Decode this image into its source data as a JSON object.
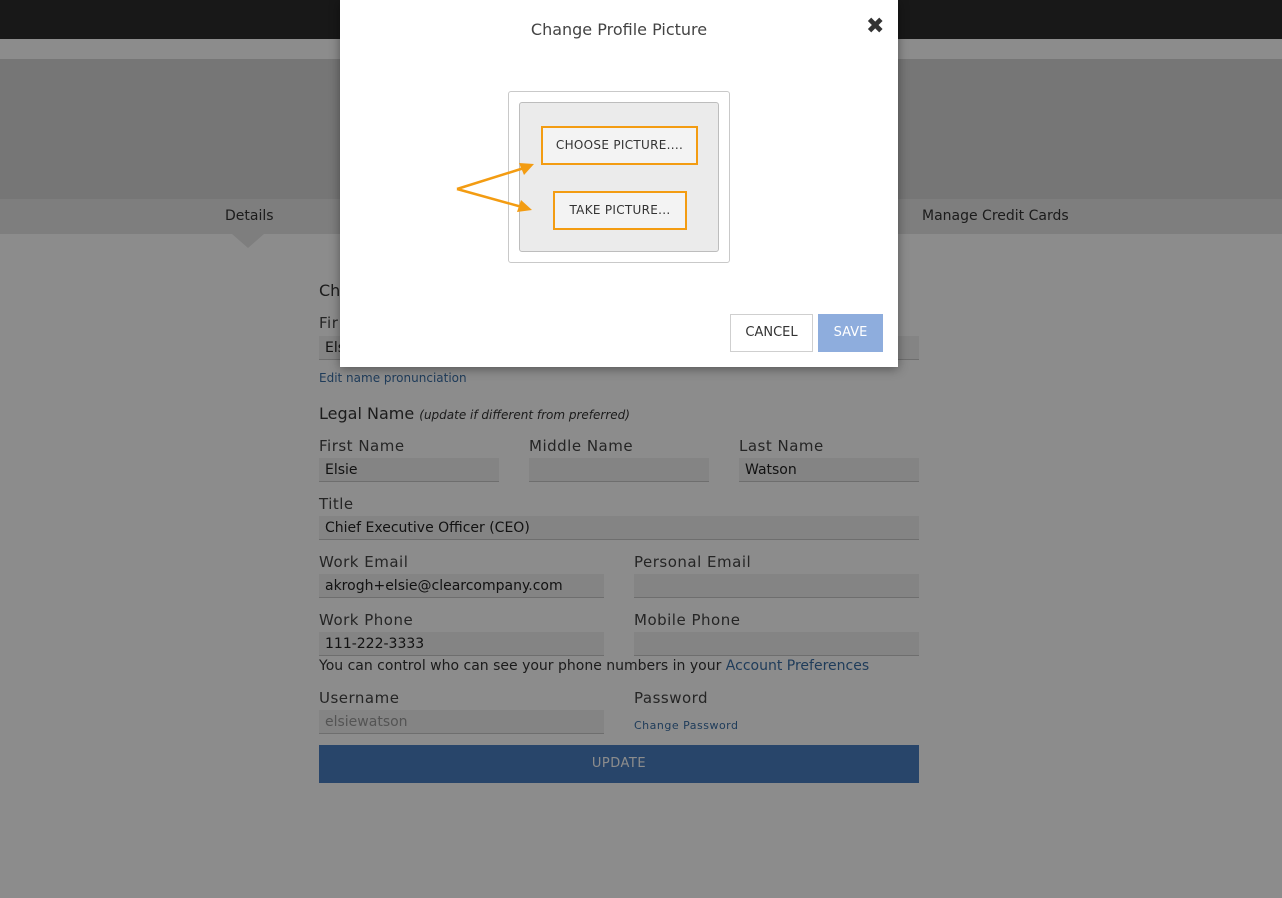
{
  "tabs": {
    "details": "Details",
    "manage_credit_cards": "Manage Credit Cards"
  },
  "form": {
    "preferred_section_partial": "Ch",
    "preferred_first_label_partial": "Fir",
    "preferred_first_value_partial": "Els",
    "edit_pronunciation_link": "Edit name pronunciation",
    "legal_name_heading": "Legal Name",
    "legal_name_note": "(update if different from preferred)",
    "first_name_label": "First Name",
    "first_name_value": "Elsie",
    "middle_name_label": "Middle Name",
    "middle_name_value": "",
    "last_name_label": "Last Name",
    "last_name_value": "Watson",
    "title_label": "Title",
    "title_value": "Chief Executive Officer (CEO)",
    "work_email_label": "Work Email",
    "work_email_value": "akrogh+elsie@clearcompany.com",
    "personal_email_label": "Personal Email",
    "personal_email_value": "",
    "work_phone_label": "Work Phone",
    "work_phone_value": "111-222-3333",
    "mobile_phone_label": "Mobile Phone",
    "mobile_phone_value": "",
    "phone_note": "You can control who can see your phone numbers in your",
    "account_preferences_link": "Account Preferences",
    "username_label": "Username",
    "username_value": "elsiewatson",
    "password_label": "Password",
    "change_password_link": "Change Password",
    "update_button": "UPDATE"
  },
  "modal": {
    "title": "Change Profile Picture",
    "close_icon": "close-icon",
    "choose_picture_button": "CHOOSE PICTURE....",
    "take_picture_button": "TAKE PICTURE...",
    "cancel_button": "CANCEL",
    "save_button": "SAVE",
    "highlight_color": "#f39c12"
  },
  "colors": {
    "accent_blue": "#4a7fc1",
    "link_blue": "#3a6ea5",
    "save_disabled": "#8eaddd"
  }
}
